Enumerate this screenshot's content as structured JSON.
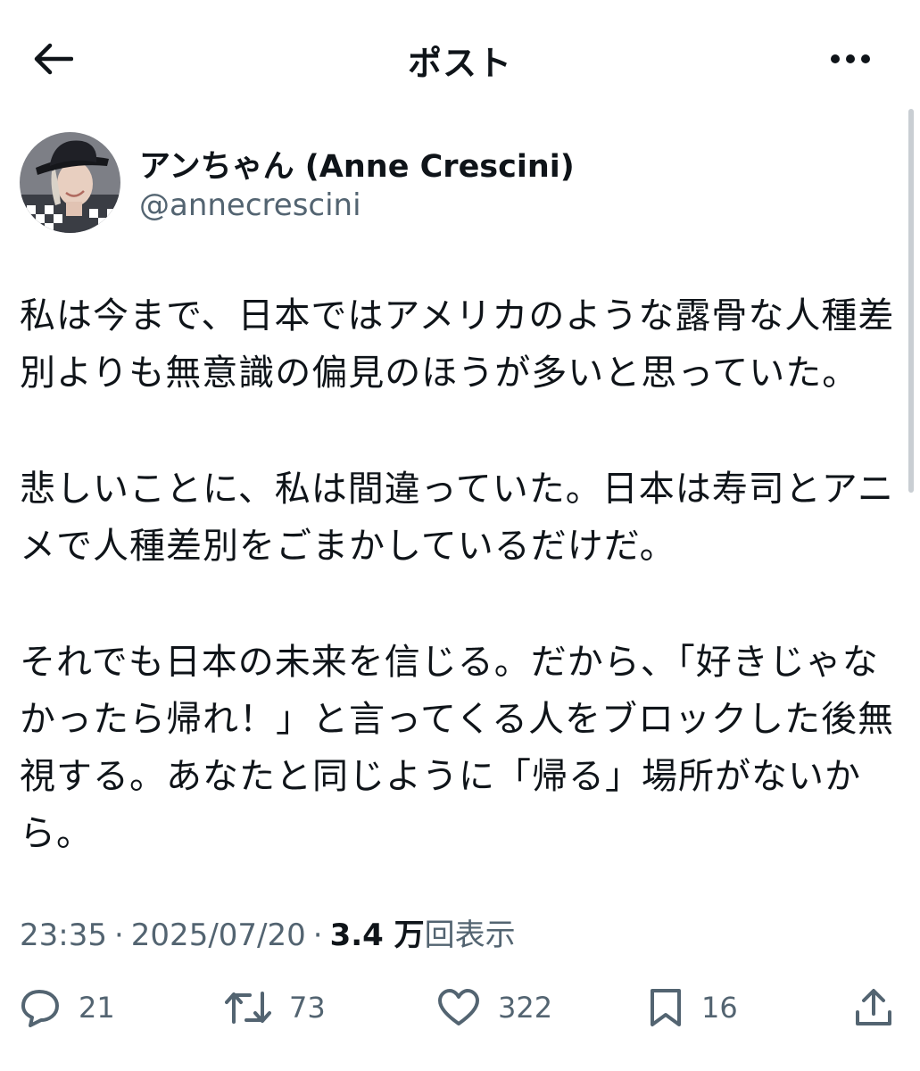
{
  "header": {
    "title": "ポスト",
    "back_icon": "arrow-left-icon",
    "more_icon": "ellipsis-icon"
  },
  "author": {
    "display_name": "アンちゃん (Anne Crescini)",
    "handle": "@annecrescini",
    "avatar_icon": "avatar-photo"
  },
  "tweet": {
    "paragraphs": [
      [
        "私は今まで、日本ではアメリカのような露骨な人種差",
        "別よりも無意識の偏見のほうが多いと思っていた。"
      ],
      [
        "悲しいことに、私は間違っていた。日本は寿司とアニ",
        "メで人種差別をごまかしているだけだ。"
      ],
      [
        "それでも日本の未来を信じる。だから、「好きじゃな",
        "かったら帰れ！」と言ってくる人をブロックした後無",
        "視する。あなたと同じように「帰る」場所がないか",
        "ら。"
      ]
    ]
  },
  "meta": {
    "time": "23:35",
    "date": "2025/07/20",
    "separator": "·",
    "views_count": "3.4 万",
    "views_label": "回表示"
  },
  "actions": {
    "reply": {
      "icon": "reply-icon",
      "count": "21"
    },
    "retweet": {
      "icon": "retweet-icon",
      "count": "73"
    },
    "like": {
      "icon": "heart-icon",
      "count": "322"
    },
    "bookmark": {
      "icon": "bookmark-icon",
      "count": "16"
    },
    "share": {
      "icon": "share-icon"
    }
  },
  "colors": {
    "text_primary": "#0f1419",
    "text_secondary": "#536471",
    "background": "#ffffff"
  }
}
